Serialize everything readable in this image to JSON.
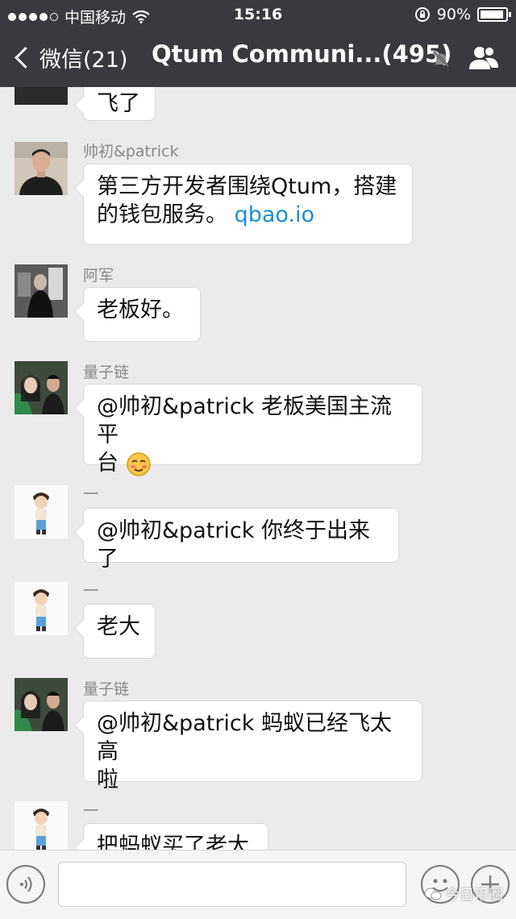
{
  "status_bar": {
    "carrier": "中国移动",
    "time": "15:16",
    "battery": "90%"
  },
  "nav": {
    "back_label": "微信(21)",
    "title": "Qtum Communi...(495)"
  },
  "messages": [
    {
      "sender": "",
      "lines": [
        "飞了"
      ]
    },
    {
      "sender": "帅初&patrick",
      "lines": [
        "第三方开发者围绕Qtum，搭建",
        "的钱包服务。 "
      ],
      "link": "qbao.io"
    },
    {
      "sender": "阿军",
      "lines": [
        "老板好。"
      ]
    },
    {
      "sender": "量子链",
      "lines": [
        "@帅初&patrick 老板美国主流平",
        "台"
      ]
    },
    {
      "sender": "一",
      "lines": [
        "@帅初&patrick 你终于出来了"
      ]
    },
    {
      "sender": "一",
      "lines": [
        "老大"
      ]
    },
    {
      "sender": "量子链",
      "lines": [
        "@帅初&patrick 蚂蚁已经飞太高",
        "啦"
      ]
    },
    {
      "sender": "一",
      "lines": [
        "把蚂蚁买了老大"
      ]
    }
  ],
  "watermark": "今日币圈",
  "icons": [
    "back-chevron-icon",
    "mute-bell-icon",
    "group-members-icon",
    "voice-icon",
    "emoji-icon",
    "plus-icon"
  ],
  "colors": {
    "header": "#393a3f",
    "chat_bg": "#ebebeb",
    "link": "#1a8fd2"
  }
}
